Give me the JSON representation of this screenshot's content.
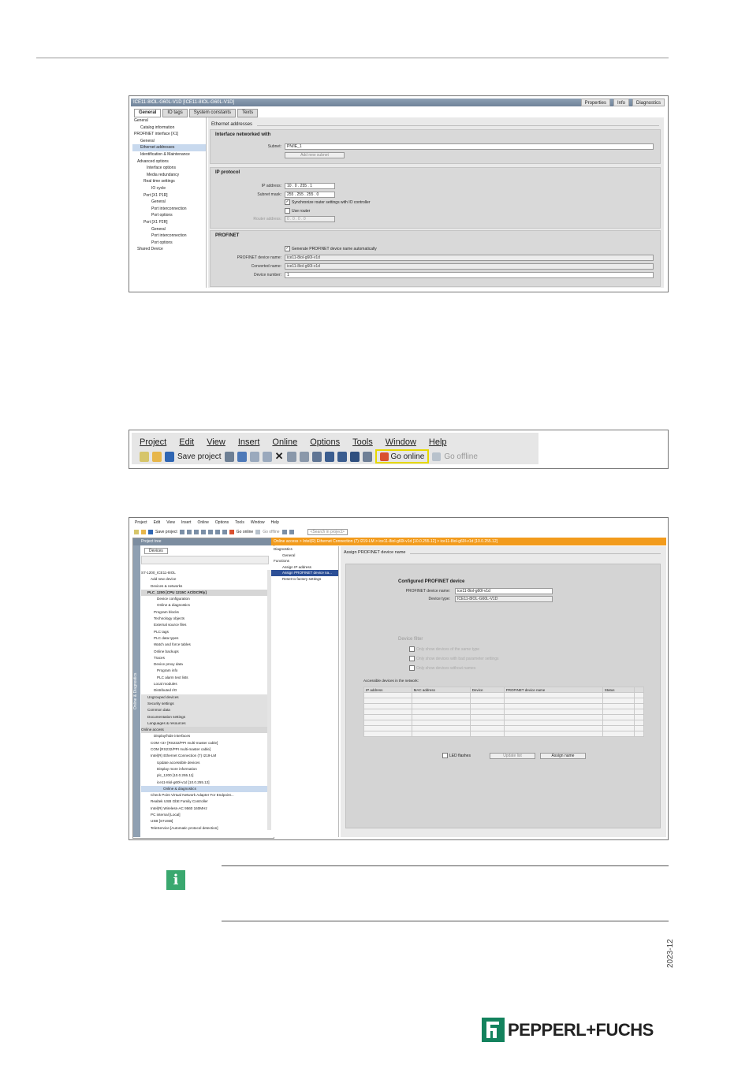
{
  "fig1": {
    "window_title": "ICE11-8IOL-G60L-V1D [ICE11-8IOL-G60L-V1D]",
    "right_tabs": [
      "Properties",
      "Info",
      "Diagnostics"
    ],
    "tabs": [
      "General",
      "IO tags",
      "System constants",
      "Texts"
    ],
    "tree": [
      "General",
      "Catalog information",
      "PROFINET interface [X1]",
      "General",
      "Ethernet addresses",
      "Identification & Maintenance",
      "Advanced options",
      "Interface options",
      "Media redundancy",
      "Real time settings",
      "IO cycle",
      "Port [X1 P1R]",
      "General",
      "Port interconnection",
      "Port options",
      "Port [X1 P2R]",
      "General",
      "Port interconnection",
      "Port options",
      "Shared Device"
    ],
    "section": "Ethernet addresses",
    "iface": {
      "header": "Interface networked with",
      "subnet_label": "Subnet:",
      "subnet_value": "PN/IE_1",
      "add_button": "Add new subnet"
    },
    "ip": {
      "header": "IP protocol",
      "ip_label": "IP address:",
      "ip_value": "10 . 0 . 255 . 1",
      "mask_label": "Subnet mask:",
      "mask_value": "255 . 255 . 255 . 0",
      "sync": "Synchronize router settings with IO controller",
      "use_router": "Use router",
      "router_label": "Router address:",
      "router_value": "0 . 0 . 0 . 0"
    },
    "pn": {
      "header": "PROFINET",
      "gen_auto": "Generate PROFINET device name automatically",
      "name_label": "PROFINET device name:",
      "name_value": "ice11-8iol-g60l-v1d",
      "conv_label": "Converted name:",
      "conv_value": "ice11-8iol-g60l-v1d",
      "num_label": "Device number:",
      "num_value": "1"
    }
  },
  "fig2": {
    "menus": [
      "Project",
      "Edit",
      "View",
      "Insert",
      "Online",
      "Options",
      "Tools",
      "Window",
      "Help"
    ],
    "save": "Save project",
    "go_online": "Go online",
    "go_offline": "Go offline"
  },
  "fig3": {
    "menus": [
      "Project",
      "Edit",
      "View",
      "Insert",
      "Online",
      "Options",
      "Tools",
      "Window",
      "Help"
    ],
    "save": "Save project",
    "go_online": "Go online",
    "go_offline": "Go offline",
    "search": "<Search in project>",
    "tree_header": "Project tree",
    "devices_tab": "Devices",
    "side_label": "Online & Diagnostics",
    "tree_items": [
      "S7-1200_ICE11-8IOL",
      "Add new device",
      "Devices & networks",
      "PLC_1200 [CPU 1215C AC/DC/Rly]",
      "Device configuration",
      "Online & diagnostics",
      "Program blocks",
      "Technology objects",
      "External source files",
      "PLC tags",
      "PLC data types",
      "Watch and force tables",
      "Online backups",
      "Traces",
      "Device proxy data",
      "Program info",
      "PLC alarm text lists",
      "Local modules",
      "Distributed I/O",
      "Ungrouped devices",
      "Security settings",
      "Common data",
      "Documentation settings",
      "Languages & resources",
      "Online access",
      "Display/hide interfaces",
      "COM <3> [RS232/PPI multi-master cable]",
      "COM [RS232/PPI multi-master cable]",
      "Intel(R) Ethernet Connection (7) I219-LM",
      "Update accessible devices",
      "Display more information",
      "plc_1200 [10.0.255.11]",
      "ice11-8iol-g60l-v1d [10.0.255.12]",
      "Online & diagnostics",
      "Check Point Virtual Network Adapter For Endpoint...",
      "Realtek USB GbE Family Controller",
      "Intel(R) Wireless-AC 9560 160MHz",
      "PC internal [Local]",
      "USB [S7USB]",
      "TeleService [Automatic protocol detection]"
    ],
    "breadcrumb": "Online access  >  Intel(R) Ethernet Connection (7) I219-LM  >  ice11-8iol-g60l-v1d [10.0.255.12]  >  ice11-8iol-g60l-v1d [10.0.255.12]",
    "nav": [
      "Diagnostics",
      "General",
      "Functions",
      "Assign IP address",
      "Assign PROFINET device na...",
      "Reset to factory settings"
    ],
    "main_title": "Assign PROFINET device name",
    "configured": "Configured PROFINET device",
    "name_label": "PROFINET device name:",
    "name_value": "ice11-8iol-g60l-v1d",
    "type_label": "Device type:",
    "type_value": "ICE11-8IOL-G60L-V1D",
    "filter": "Device filter",
    "filter_opts": [
      "Only show devices of the same type",
      "Only show devices with bad parameter settings",
      "Only show devices without names"
    ],
    "accessible": "Accessible devices in the network:",
    "columns": [
      "IP address",
      "MAC address",
      "Device",
      "PROFINET device name",
      "Status"
    ],
    "led": "LED flashes",
    "update": "Update list",
    "assign": "Assign name"
  },
  "footer": {
    "date": "2023-12",
    "brand": "PEPPERL+FUCHS"
  },
  "colors": {
    "brand_green": "#13825d",
    "info_green": "#3aa86f",
    "online_orange": "#f29b1c",
    "highlight_yellow": "#e6d800"
  }
}
